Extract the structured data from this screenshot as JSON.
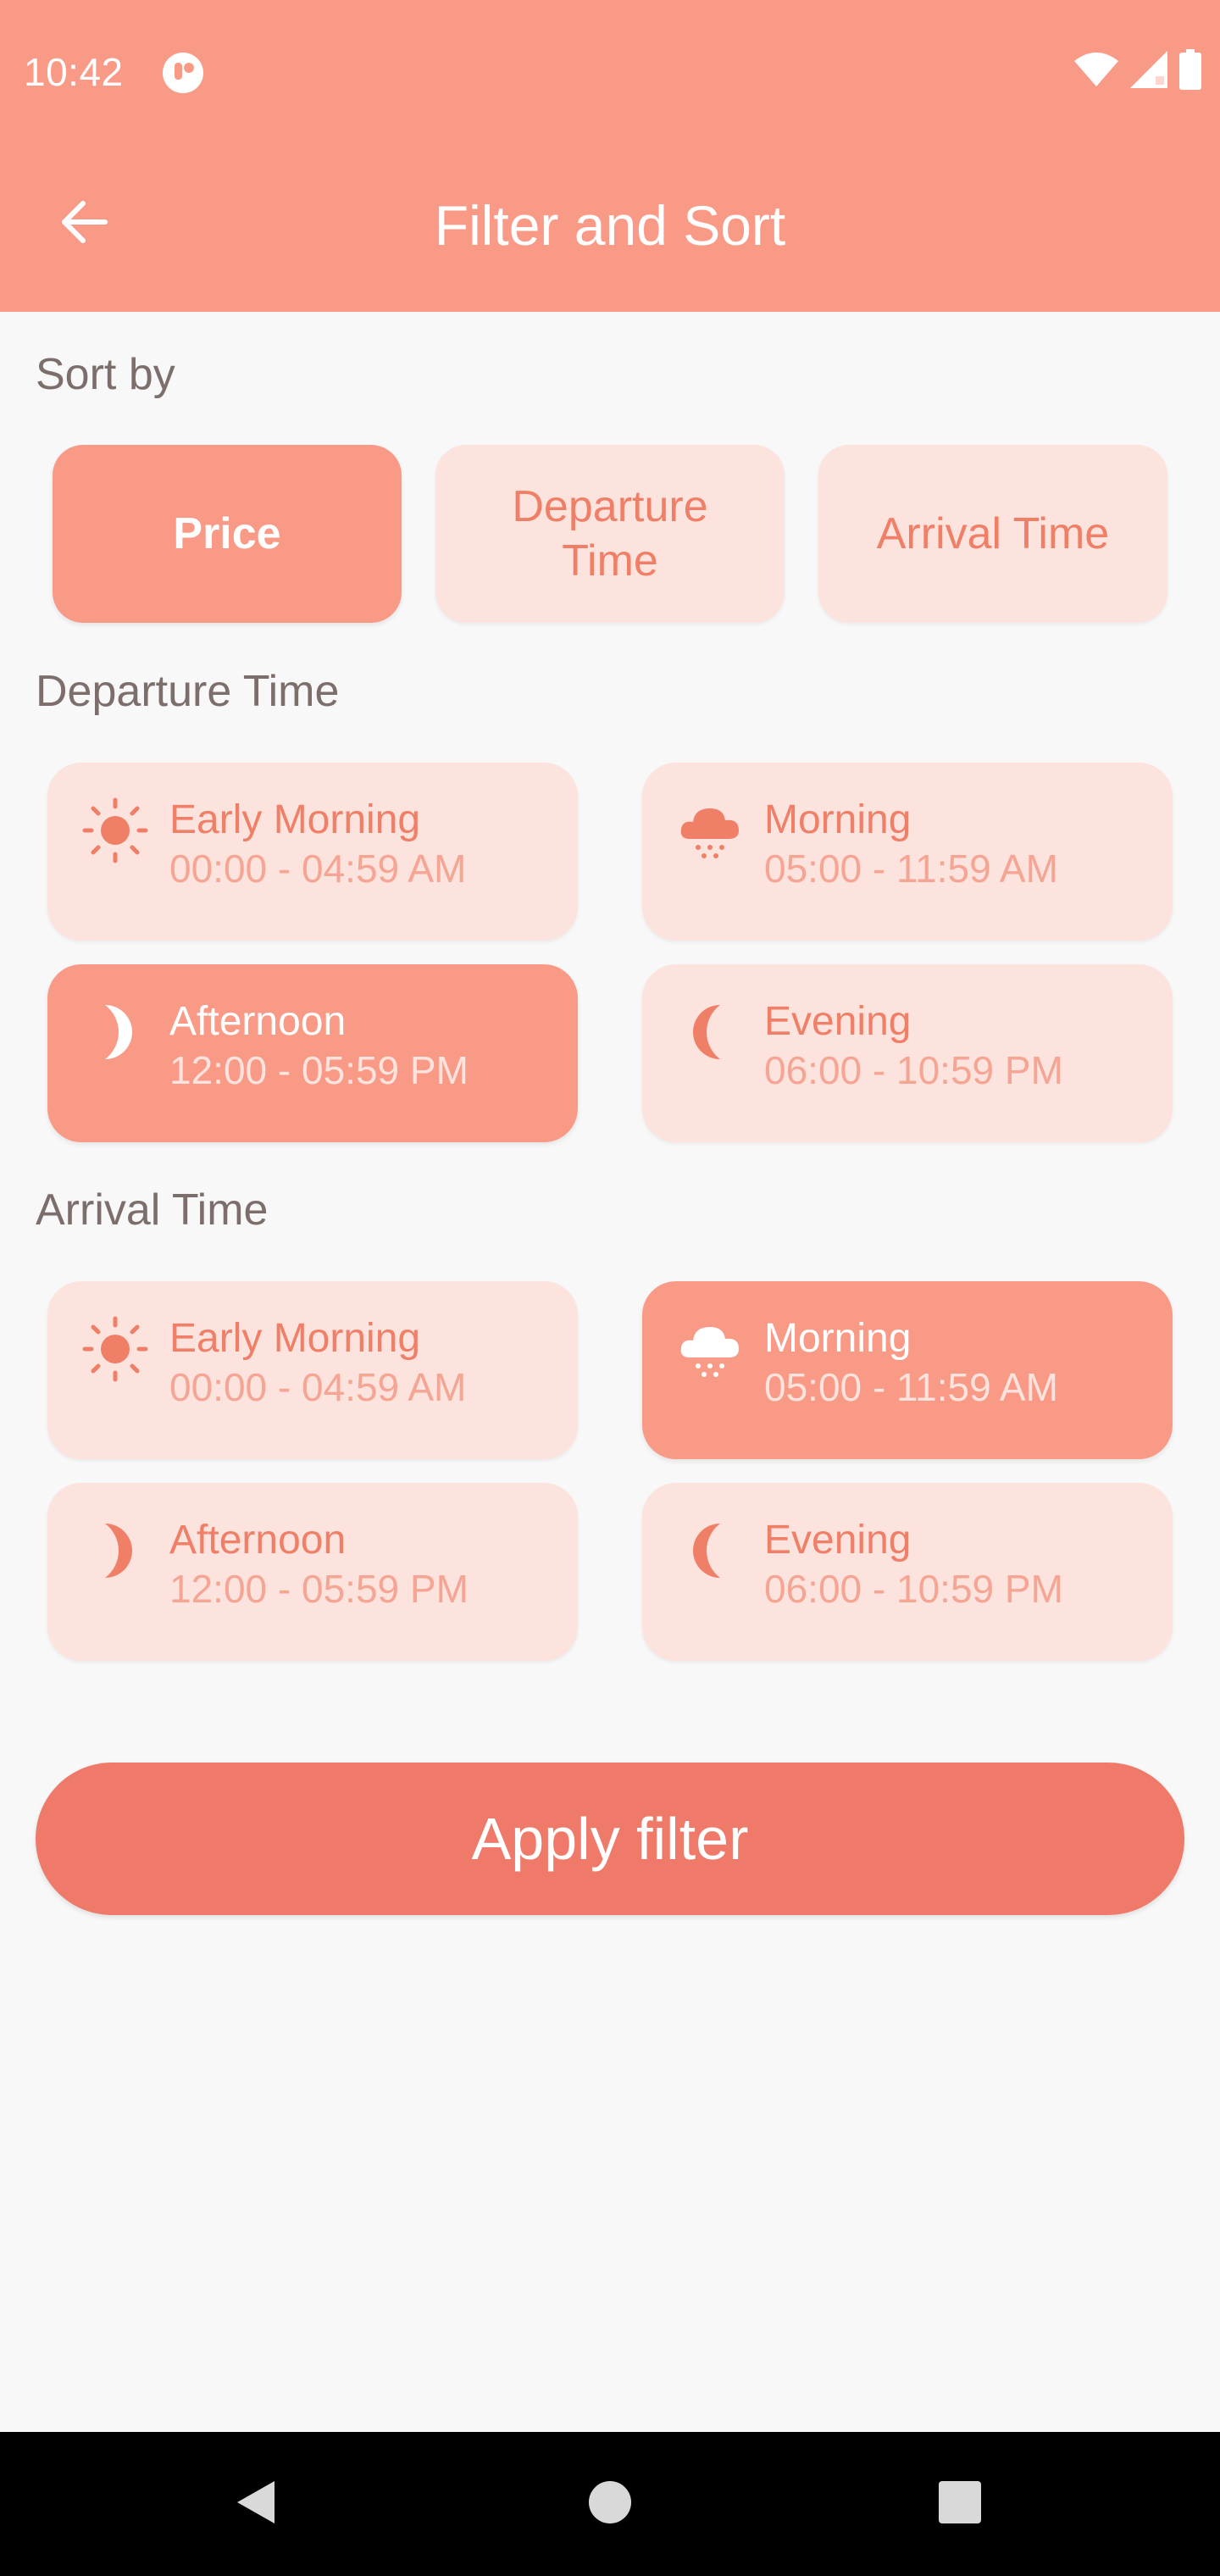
{
  "status_bar": {
    "time": "10:42",
    "icons": [
      "app-notification-icon",
      "wifi-icon",
      "signal-icon",
      "battery-icon"
    ]
  },
  "app_bar": {
    "title": "Filter and Sort",
    "back_icon": "arrow-back-icon"
  },
  "sort": {
    "title": "Sort by",
    "options": [
      {
        "label": "Price",
        "selected": true
      },
      {
        "label": "Departure Time",
        "selected": false
      },
      {
        "label": "Arrival Time",
        "selected": false
      }
    ]
  },
  "departure": {
    "title": "Departure Time",
    "slots": [
      {
        "label": "Early Morning",
        "range": "00:00 - 04:59 AM",
        "icon": "sun-icon",
        "selected": false
      },
      {
        "label": "Morning",
        "range": "05:00 - 11:59 AM",
        "icon": "cloud-snow-icon",
        "selected": false
      },
      {
        "label": "Afternoon",
        "range": "12:00 - 05:59 PM",
        "icon": "half-moon-icon",
        "selected": true
      },
      {
        "label": "Evening",
        "range": "06:00 - 10:59 PM",
        "icon": "crescent-moon-icon",
        "selected": false
      }
    ]
  },
  "arrival": {
    "title": "Arrival Time",
    "slots": [
      {
        "label": "Early Morning",
        "range": "00:00 - 04:59 AM",
        "icon": "sun-icon",
        "selected": false
      },
      {
        "label": "Morning",
        "range": "05:00 - 11:59 AM",
        "icon": "cloud-snow-icon",
        "selected": true
      },
      {
        "label": "Afternoon",
        "range": "12:00 - 05:59 PM",
        "icon": "half-moon-icon",
        "selected": false
      },
      {
        "label": "Evening",
        "range": "06:00 - 10:59 PM",
        "icon": "crescent-moon-icon",
        "selected": false
      }
    ]
  },
  "apply_button": {
    "label": "Apply filter"
  },
  "nav_bar": {
    "icons": [
      "back-triangle-icon",
      "home-circle-icon",
      "recents-square-icon"
    ]
  },
  "colors": {
    "primary": "#f99a87",
    "accent": "#ef7a69",
    "chip_inactive": "#fde3dd",
    "text_muted": "#7b6e6b"
  }
}
